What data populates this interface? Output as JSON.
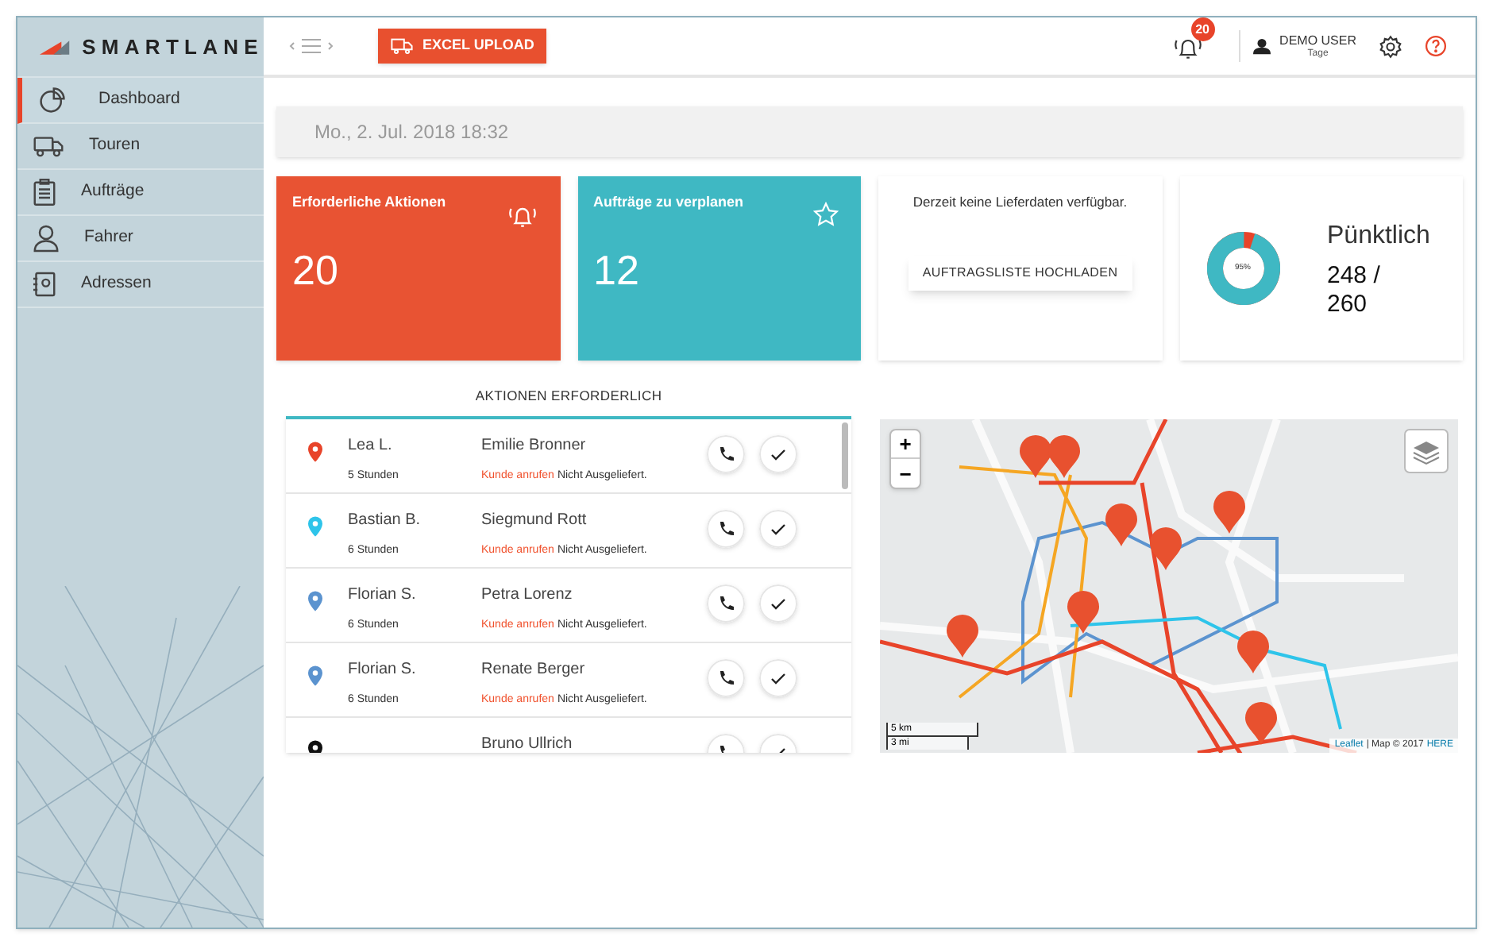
{
  "brand": "SMARTLANE",
  "sidebar": {
    "items": [
      {
        "label": "Dashboard",
        "selected": true
      },
      {
        "label": "Touren",
        "selected": false
      },
      {
        "label": "Aufträge",
        "selected": false
      },
      {
        "label": "Fahrer",
        "selected": false
      },
      {
        "label": "Adressen",
        "selected": false
      }
    ]
  },
  "header": {
    "upload_button": "EXCEL UPLOAD",
    "notification_count": "20",
    "user_name": "DEMO USER",
    "user_sub": "Tage"
  },
  "date": "Mo., 2. Jul. 2018 18:32",
  "cards": [
    {
      "kind": "stat",
      "title": "Erforderliche Aktionen",
      "value": "20",
      "color": "#e85333"
    },
    {
      "kind": "stat",
      "title": "Aufträge zu verplanen",
      "value": "12",
      "color": "#3fb8c3"
    },
    {
      "kind": "upload",
      "message": "Derzeit keine Lieferdaten verfügbar.",
      "button": "AUFTRAGSLISTE HOCHLADEN"
    },
    {
      "kind": "donut",
      "level": 0.95,
      "percent": "95%",
      "title": "Pünktlich",
      "value": "248 / 260"
    }
  ],
  "actions": {
    "title": "AKTIONEN ERFORDERLICH",
    "rows": [
      {
        "color": "#e8442a",
        "driver": "Lea L.",
        "time": "5 Stunden",
        "customer": "Emilie Bronner",
        "action": "Kunde anrufen",
        "status": "Nicht Ausgeliefert."
      },
      {
        "color": "#2ec4ea",
        "driver": "Bastian B.",
        "time": "6 Stunden",
        "customer": "Siegmund Rott",
        "action": "Kunde anrufen",
        "status": "Nicht Ausgeliefert."
      },
      {
        "color": "#5b93cf",
        "driver": "Florian S.",
        "time": "6 Stunden",
        "customer": "Petra Lorenz",
        "action": "Kunde anrufen",
        "status": "Nicht Ausgeliefert."
      },
      {
        "color": "#5b93cf",
        "driver": "Florian S.",
        "time": "6 Stunden",
        "customer": "Renate Berger",
        "action": "Kunde anrufen",
        "status": "Nicht Ausgeliefert."
      },
      {
        "color": "#111111",
        "customer": "Bruno Ullrich"
      }
    ]
  },
  "map": {
    "zoom_in": "+",
    "zoom_out": "−",
    "scale_km": "5 km",
    "scale_mi": "3 mi",
    "attribution_link": "Leaflet",
    "attribution_text": "| Map © 2017",
    "attribution_provider": "HERE"
  }
}
